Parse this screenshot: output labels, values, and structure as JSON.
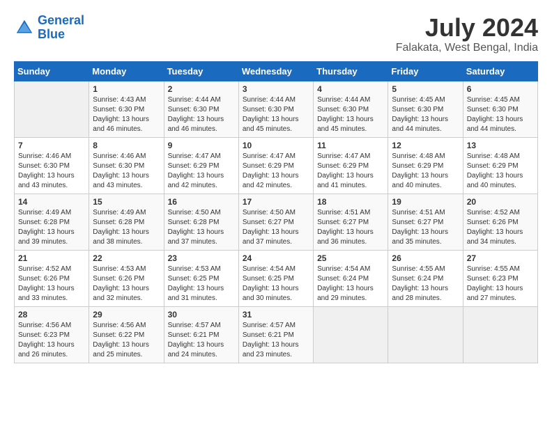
{
  "logo": {
    "line1": "General",
    "line2": "Blue"
  },
  "title": "July 2024",
  "location": "Falakata, West Bengal, India",
  "days_header": [
    "Sunday",
    "Monday",
    "Tuesday",
    "Wednesday",
    "Thursday",
    "Friday",
    "Saturday"
  ],
  "weeks": [
    [
      {
        "day": "",
        "sunrise": "",
        "sunset": "",
        "daylight": ""
      },
      {
        "day": "1",
        "sunrise": "Sunrise: 4:43 AM",
        "sunset": "Sunset: 6:30 PM",
        "daylight": "Daylight: 13 hours and 46 minutes."
      },
      {
        "day": "2",
        "sunrise": "Sunrise: 4:44 AM",
        "sunset": "Sunset: 6:30 PM",
        "daylight": "Daylight: 13 hours and 46 minutes."
      },
      {
        "day": "3",
        "sunrise": "Sunrise: 4:44 AM",
        "sunset": "Sunset: 6:30 PM",
        "daylight": "Daylight: 13 hours and 45 minutes."
      },
      {
        "day": "4",
        "sunrise": "Sunrise: 4:44 AM",
        "sunset": "Sunset: 6:30 PM",
        "daylight": "Daylight: 13 hours and 45 minutes."
      },
      {
        "day": "5",
        "sunrise": "Sunrise: 4:45 AM",
        "sunset": "Sunset: 6:30 PM",
        "daylight": "Daylight: 13 hours and 44 minutes."
      },
      {
        "day": "6",
        "sunrise": "Sunrise: 4:45 AM",
        "sunset": "Sunset: 6:30 PM",
        "daylight": "Daylight: 13 hours and 44 minutes."
      }
    ],
    [
      {
        "day": "7",
        "sunrise": "Sunrise: 4:46 AM",
        "sunset": "Sunset: 6:30 PM",
        "daylight": "Daylight: 13 hours and 43 minutes."
      },
      {
        "day": "8",
        "sunrise": "Sunrise: 4:46 AM",
        "sunset": "Sunset: 6:30 PM",
        "daylight": "Daylight: 13 hours and 43 minutes."
      },
      {
        "day": "9",
        "sunrise": "Sunrise: 4:47 AM",
        "sunset": "Sunset: 6:29 PM",
        "daylight": "Daylight: 13 hours and 42 minutes."
      },
      {
        "day": "10",
        "sunrise": "Sunrise: 4:47 AM",
        "sunset": "Sunset: 6:29 PM",
        "daylight": "Daylight: 13 hours and 42 minutes."
      },
      {
        "day": "11",
        "sunrise": "Sunrise: 4:47 AM",
        "sunset": "Sunset: 6:29 PM",
        "daylight": "Daylight: 13 hours and 41 minutes."
      },
      {
        "day": "12",
        "sunrise": "Sunrise: 4:48 AM",
        "sunset": "Sunset: 6:29 PM",
        "daylight": "Daylight: 13 hours and 40 minutes."
      },
      {
        "day": "13",
        "sunrise": "Sunrise: 4:48 AM",
        "sunset": "Sunset: 6:29 PM",
        "daylight": "Daylight: 13 hours and 40 minutes."
      }
    ],
    [
      {
        "day": "14",
        "sunrise": "Sunrise: 4:49 AM",
        "sunset": "Sunset: 6:28 PM",
        "daylight": "Daylight: 13 hours and 39 minutes."
      },
      {
        "day": "15",
        "sunrise": "Sunrise: 4:49 AM",
        "sunset": "Sunset: 6:28 PM",
        "daylight": "Daylight: 13 hours and 38 minutes."
      },
      {
        "day": "16",
        "sunrise": "Sunrise: 4:50 AM",
        "sunset": "Sunset: 6:28 PM",
        "daylight": "Daylight: 13 hours and 37 minutes."
      },
      {
        "day": "17",
        "sunrise": "Sunrise: 4:50 AM",
        "sunset": "Sunset: 6:27 PM",
        "daylight": "Daylight: 13 hours and 37 minutes."
      },
      {
        "day": "18",
        "sunrise": "Sunrise: 4:51 AM",
        "sunset": "Sunset: 6:27 PM",
        "daylight": "Daylight: 13 hours and 36 minutes."
      },
      {
        "day": "19",
        "sunrise": "Sunrise: 4:51 AM",
        "sunset": "Sunset: 6:27 PM",
        "daylight": "Daylight: 13 hours and 35 minutes."
      },
      {
        "day": "20",
        "sunrise": "Sunrise: 4:52 AM",
        "sunset": "Sunset: 6:26 PM",
        "daylight": "Daylight: 13 hours and 34 minutes."
      }
    ],
    [
      {
        "day": "21",
        "sunrise": "Sunrise: 4:52 AM",
        "sunset": "Sunset: 6:26 PM",
        "daylight": "Daylight: 13 hours and 33 minutes."
      },
      {
        "day": "22",
        "sunrise": "Sunrise: 4:53 AM",
        "sunset": "Sunset: 6:26 PM",
        "daylight": "Daylight: 13 hours and 32 minutes."
      },
      {
        "day": "23",
        "sunrise": "Sunrise: 4:53 AM",
        "sunset": "Sunset: 6:25 PM",
        "daylight": "Daylight: 13 hours and 31 minutes."
      },
      {
        "day": "24",
        "sunrise": "Sunrise: 4:54 AM",
        "sunset": "Sunset: 6:25 PM",
        "daylight": "Daylight: 13 hours and 30 minutes."
      },
      {
        "day": "25",
        "sunrise": "Sunrise: 4:54 AM",
        "sunset": "Sunset: 6:24 PM",
        "daylight": "Daylight: 13 hours and 29 minutes."
      },
      {
        "day": "26",
        "sunrise": "Sunrise: 4:55 AM",
        "sunset": "Sunset: 6:24 PM",
        "daylight": "Daylight: 13 hours and 28 minutes."
      },
      {
        "day": "27",
        "sunrise": "Sunrise: 4:55 AM",
        "sunset": "Sunset: 6:23 PM",
        "daylight": "Daylight: 13 hours and 27 minutes."
      }
    ],
    [
      {
        "day": "28",
        "sunrise": "Sunrise: 4:56 AM",
        "sunset": "Sunset: 6:23 PM",
        "daylight": "Daylight: 13 hours and 26 minutes."
      },
      {
        "day": "29",
        "sunrise": "Sunrise: 4:56 AM",
        "sunset": "Sunset: 6:22 PM",
        "daylight": "Daylight: 13 hours and 25 minutes."
      },
      {
        "day": "30",
        "sunrise": "Sunrise: 4:57 AM",
        "sunset": "Sunset: 6:21 PM",
        "daylight": "Daylight: 13 hours and 24 minutes."
      },
      {
        "day": "31",
        "sunrise": "Sunrise: 4:57 AM",
        "sunset": "Sunset: 6:21 PM",
        "daylight": "Daylight: 13 hours and 23 minutes."
      },
      {
        "day": "",
        "sunrise": "",
        "sunset": "",
        "daylight": ""
      },
      {
        "day": "",
        "sunrise": "",
        "sunset": "",
        "daylight": ""
      },
      {
        "day": "",
        "sunrise": "",
        "sunset": "",
        "daylight": ""
      }
    ]
  ]
}
